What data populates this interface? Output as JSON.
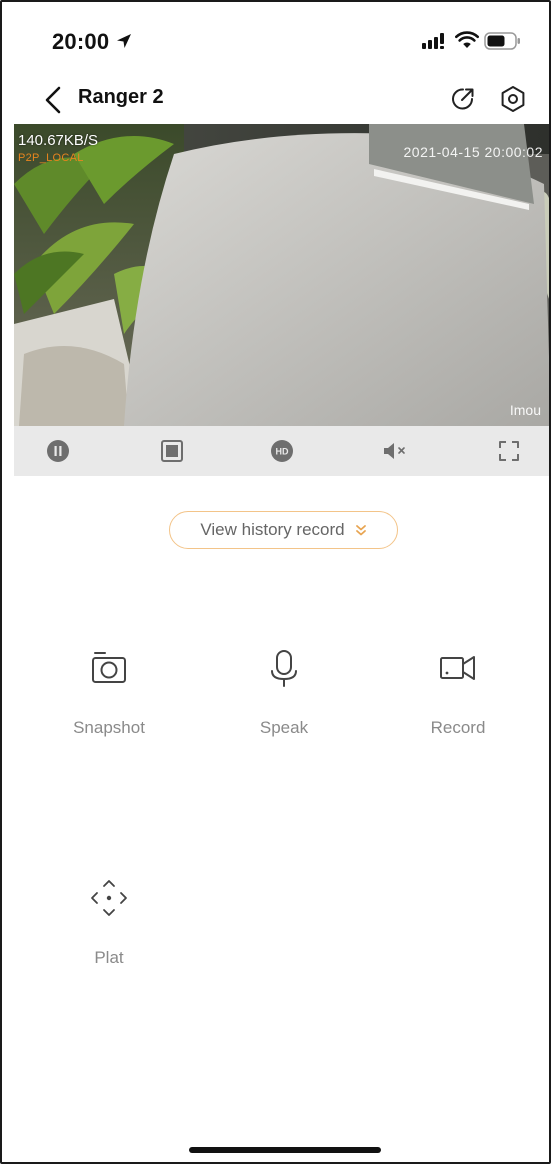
{
  "status_bar": {
    "time": "20:00"
  },
  "nav": {
    "title": "Ranger 2"
  },
  "video": {
    "bitrate": "140.67KB/S",
    "connection_mode": "P2P_LOCAL",
    "timestamp": "2021-04-15 20:00:02",
    "watermark": "Imou"
  },
  "controls": {
    "items": [
      "pause-icon",
      "stop-icon",
      "hd-icon",
      "mute-icon",
      "fullscreen-icon"
    ]
  },
  "history": {
    "label": "View history record"
  },
  "functions": [
    {
      "label": "Snapshot",
      "icon": "camera-icon"
    },
    {
      "label": "Speak",
      "icon": "microphone-icon"
    },
    {
      "label": "Record",
      "icon": "video-record-icon"
    },
    {
      "label": "Plat",
      "icon": "ptz-direction-icon"
    }
  ],
  "colors": {
    "accent": "#f3c489",
    "osd_mode": "#e8841e",
    "label_gray": "#8a8a8a"
  }
}
